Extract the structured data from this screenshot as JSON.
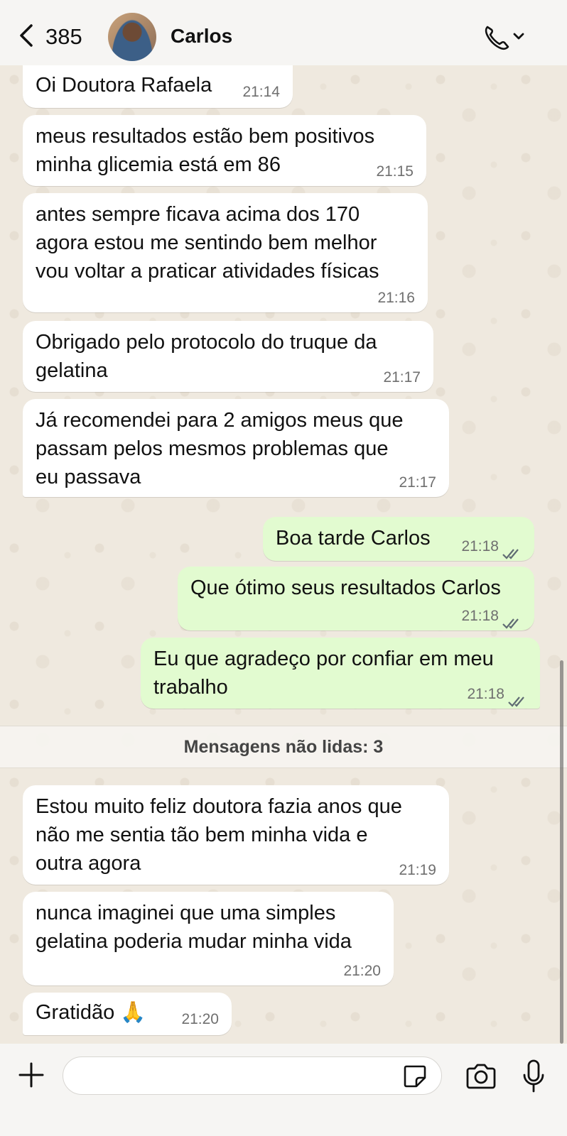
{
  "header": {
    "unread_count": "385",
    "contact_name": "Carlos"
  },
  "messages": [
    {
      "dir": "in",
      "text": "Oi Doutora Rafaela",
      "time": "21:14"
    },
    {
      "dir": "in",
      "text": "meus resultados estão bem positivos\nminha glicemia está em 86",
      "time": "21:15"
    },
    {
      "dir": "in",
      "text": "antes sempre ficava acima dos 170\nagora estou me sentindo bem melhor\nvou voltar a praticar atividades físicas",
      "time": "21:16"
    },
    {
      "dir": "in",
      "text": "Obrigado pelo protocolo do truque da\ngelatina",
      "time": "21:17"
    },
    {
      "dir": "in",
      "text": "Já recomendei para 2 amigos meus que\npassam pelos mesmos problemas que\neu passava",
      "time": "21:17"
    },
    {
      "dir": "out",
      "text": "Boa tarde Carlos",
      "time": "21:18",
      "status": "read"
    },
    {
      "dir": "out",
      "text": "Que ótimo seus resultados Carlos",
      "time": "21:18",
      "status": "read"
    },
    {
      "dir": "out",
      "text": "Eu que agradeço por confiar em meu\ntrabalho",
      "time": "21:18",
      "status": "read"
    },
    {
      "dir": "in",
      "text": "Estou muito feliz doutora fazia anos que\nnão me sentia tão bem minha vida e\noutra agora",
      "time": "21:19"
    },
    {
      "dir": "in",
      "text": "nunca imaginei que uma simples\ngelatina poderia mudar minha vida",
      "time": "21:20"
    },
    {
      "dir": "in",
      "text": "Gratidão 🙏",
      "time": "21:20"
    }
  ],
  "unread_banner": "Mensagens não lidas: 3",
  "composer": {
    "placeholder": ""
  },
  "colors": {
    "incoming_bubble": "#ffffff",
    "outgoing_bubble": "#e2fbd0",
    "read_ticks": "#5f6b73",
    "wallpaper": "#efe9df"
  },
  "icons": [
    "back-chevron-icon",
    "phone-icon",
    "chevron-down-icon",
    "plus-icon",
    "sticker-icon",
    "camera-icon",
    "microphone-icon",
    "double-check-icon"
  ]
}
